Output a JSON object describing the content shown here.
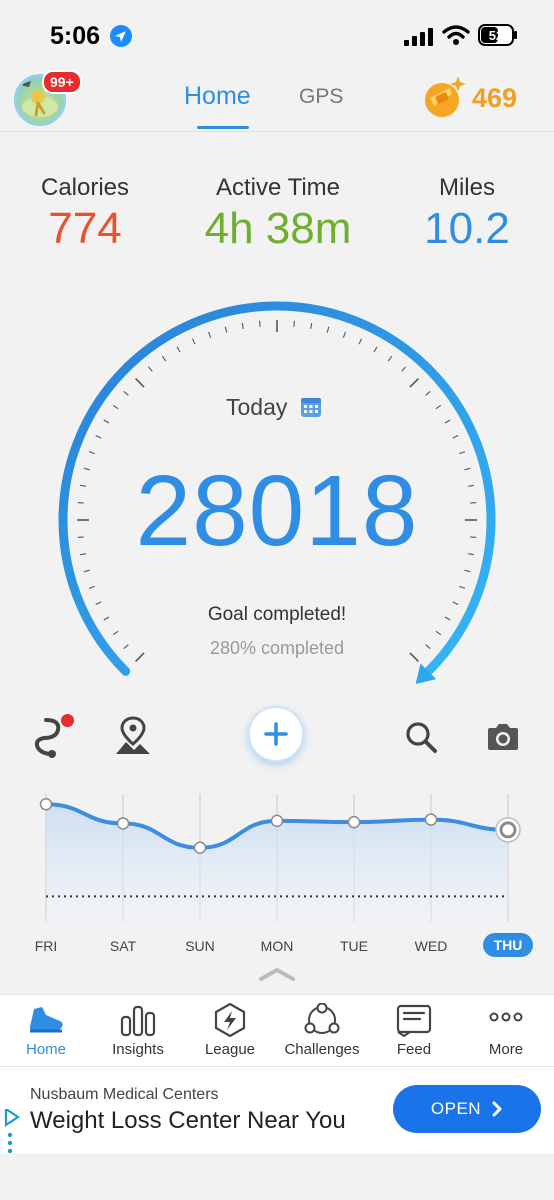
{
  "status_bar": {
    "time": "5:06",
    "battery": "52",
    "icons": [
      "location-arrow-icon",
      "signal-icon",
      "wifi-icon",
      "battery-icon"
    ]
  },
  "header": {
    "avatar_badge": "99+",
    "tabs": [
      {
        "label": "Home",
        "active": true
      },
      {
        "label": "GPS",
        "active": false
      }
    ],
    "coins": "469",
    "accent_color": "#2f8ee3"
  },
  "stats": [
    {
      "label": "Calories",
      "value": "774",
      "color": "#e8522a"
    },
    {
      "label": "Active Time",
      "value": "4h 38m",
      "color": "#6fae2e"
    },
    {
      "label": "Miles",
      "value": "10.2",
      "color": "#2f8ee3"
    }
  ],
  "gauge": {
    "period_label": "Today",
    "steps": "28018",
    "goal_text": "Goal completed!",
    "percent_text": "280% completed",
    "progress_fraction": 1.0
  },
  "actions": {
    "icons": [
      "route-icon",
      "map-pin-icon",
      "add-icon",
      "search-icon",
      "camera-icon"
    ]
  },
  "week": {
    "days": [
      "FRI",
      "SAT",
      "SUN",
      "MON",
      "TUE",
      "WED",
      "THU"
    ],
    "active_day": "THU",
    "relative_levels": [
      0.92,
      0.77,
      0.58,
      0.79,
      0.78,
      0.8,
      0.72
    ],
    "goal_level": 0.2
  },
  "bottom_nav": [
    {
      "label": "Home",
      "icon": "shoe-icon",
      "active": true
    },
    {
      "label": "Insights",
      "icon": "bar-chart-icon",
      "active": false
    },
    {
      "label": "League",
      "icon": "lightning-hexagon-icon",
      "active": false
    },
    {
      "label": "Challenges",
      "icon": "people-triangle-icon",
      "active": false
    },
    {
      "label": "Feed",
      "icon": "feed-card-icon",
      "active": false
    },
    {
      "label": "More",
      "icon": "more-dots-icon",
      "active": false
    }
  ],
  "ad": {
    "sponsor": "Nusbaum Medical Centers",
    "headline": "Weight Loss Center Near You",
    "cta": "OPEN"
  }
}
